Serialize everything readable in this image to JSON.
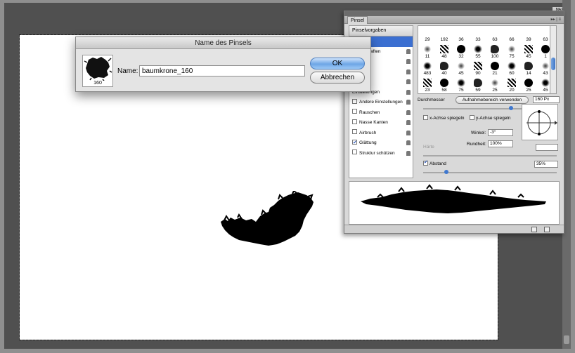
{
  "dialog": {
    "title": "Name des Pinsels",
    "thumb_caption": "160",
    "name_label": "Name:",
    "name_value": "baumkrone_160",
    "ok_label": "OK",
    "cancel_label": "Abbrechen"
  },
  "panel": {
    "tab_label": "Pinsel",
    "menu_glyph": "▸▸ | ≡",
    "preset_button": "Pinselvorgaben",
    "list_items": [
      {
        "label": "form",
        "selected": true,
        "checkbox": false,
        "lock": false
      },
      {
        "label": "eigenschaften",
        "selected": false,
        "checkbox": false,
        "lock": true
      },
      {
        "label": "ung",
        "selected": false,
        "checkbox": false,
        "lock": true
      },
      {
        "label": "ktur",
        "selected": false,
        "checkbox": false,
        "lock": true
      },
      {
        "label": "er Pinsel",
        "selected": false,
        "checkbox": false,
        "lock": true
      },
      {
        "label": "Einstellungen",
        "selected": false,
        "checkbox": false,
        "lock": true
      },
      {
        "label": "Andere Einstellungen",
        "selected": false,
        "checkbox": true,
        "checked": false,
        "lock": true
      },
      {
        "label": "Rauschen",
        "selected": false,
        "checkbox": true,
        "checked": false,
        "lock": true
      },
      {
        "label": "Nasse Kanten",
        "selected": false,
        "checkbox": true,
        "checked": false,
        "lock": true
      },
      {
        "label": "Airbrush",
        "selected": false,
        "checkbox": true,
        "checked": false,
        "lock": true
      },
      {
        "label": "Glättung",
        "selected": false,
        "checkbox": true,
        "checked": true,
        "lock": true
      },
      {
        "label": "Struktur schützen",
        "selected": false,
        "checkbox": true,
        "checked": false,
        "lock": true
      }
    ],
    "preset_rows": [
      [
        "29",
        "192",
        "36",
        "33",
        "63",
        "66",
        "39",
        "63"
      ],
      [
        "11",
        "48",
        "32",
        "55",
        "100",
        "75",
        "45",
        "1"
      ],
      [
        "483",
        "40",
        "45",
        "90",
        "21",
        "60",
        "14",
        "43"
      ],
      [
        "23",
        "58",
        "75",
        "59",
        "25",
        "20",
        "25",
        "45"
      ]
    ],
    "diameter_label": "Durchmesser",
    "sample_button": "Aufnahmebereich verwenden",
    "diameter_value": "160 Px",
    "flip_x": "x-Achse spiegeln",
    "flip_y": "y-Achse spiegeln",
    "angle_label": "Winkel:",
    "angle_value": "-3°",
    "roundness_label": "Rundheit:",
    "roundness_value": "100%",
    "hardness_label": "Härte",
    "spacing_label": "Abstand",
    "spacing_value": "35%",
    "spacing_checked": true
  },
  "colors": {
    "selection": "#3b6fd1",
    "ok_button": "#6ea6e6"
  }
}
